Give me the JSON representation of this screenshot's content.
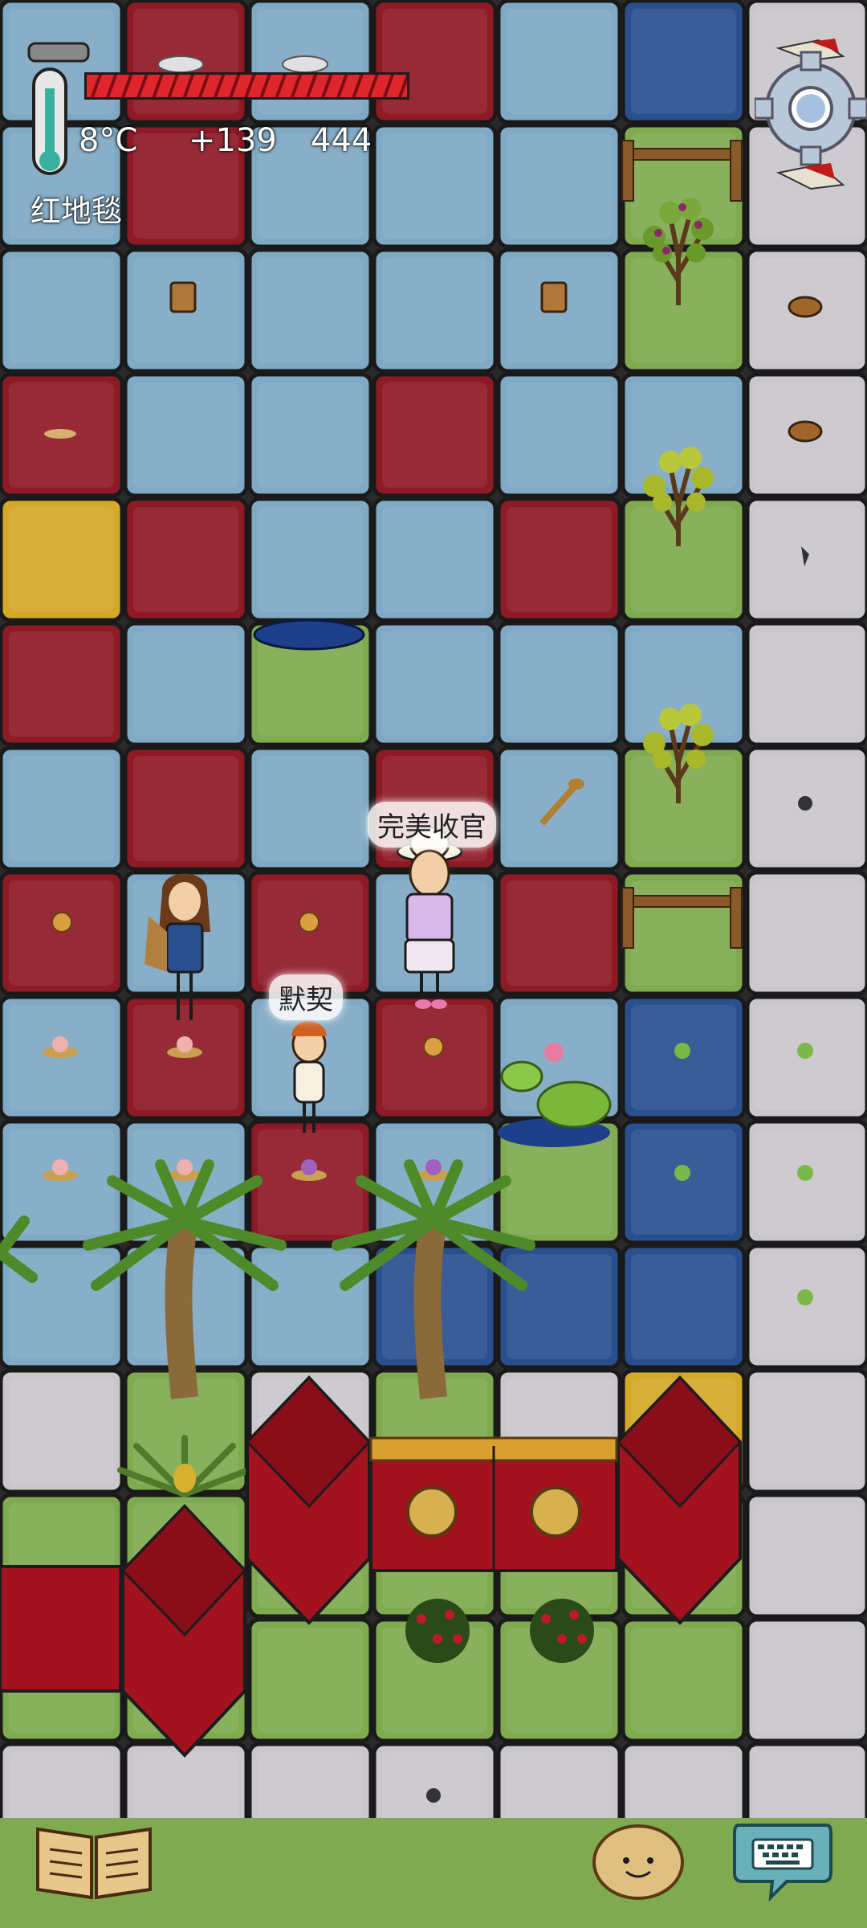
{
  "hud": {
    "temperature": "8°C",
    "yum_bonus": "+139",
    "score": "444",
    "current_item": "红地毯"
  },
  "players": [
    {
      "name": "完美收官"
    },
    {
      "name": "默契"
    }
  ],
  "colors": {
    "red_carpet": "#8e1a26",
    "blue_carpet": "#7fa9c4",
    "navy_carpet": "#2a4f8f",
    "yellow_carpet": "#d4a829",
    "grass": "#7faa4f",
    "stone": "#c9c7cc",
    "food_bar": "#e0262d"
  },
  "icons": {
    "thermometer": "thermometer-icon",
    "settings": "gear-icon",
    "tech_book": "book-icon",
    "emote": "emote-face-icon",
    "chat": "keyboard-chat-icon"
  }
}
